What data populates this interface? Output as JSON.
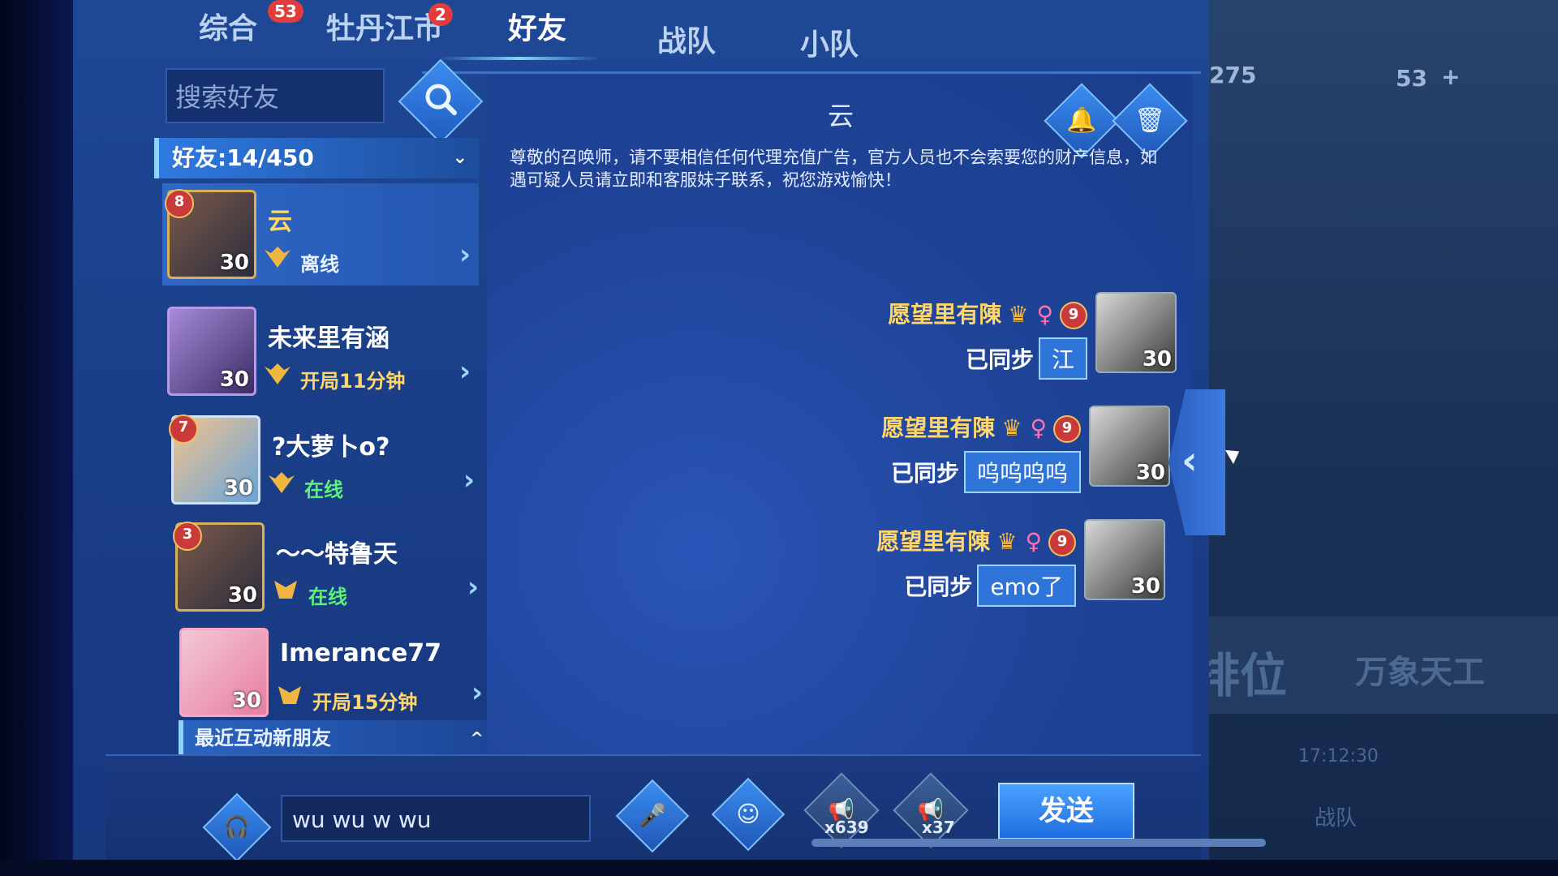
{
  "tabs": [
    {
      "label": "综合",
      "badge": "53"
    },
    {
      "label": "牡丹江市",
      "badge": "2"
    },
    {
      "label": "好友",
      "badge": ""
    },
    {
      "label": "战队",
      "badge": ""
    },
    {
      "label": "小队",
      "badge": ""
    }
  ],
  "search": {
    "placeholder": "搜索好友"
  },
  "friends_header": {
    "label": "好友:14/450",
    "chevron": "⌄"
  },
  "friends": [
    {
      "name": "云",
      "status": "离线",
      "level": "30",
      "rank_badge": "8"
    },
    {
      "name": "未来里有涵",
      "status": "开局11分钟",
      "level": "30",
      "rank_badge": ""
    },
    {
      "name": "?大萝卜o?",
      "status": "在线",
      "level": "30",
      "rank_badge": "7"
    },
    {
      "name": "～～特鲁天",
      "status": "在线",
      "level": "30",
      "rank_badge": "3"
    },
    {
      "name": "Imerance77",
      "status": "开局15分钟",
      "level": "30",
      "rank_badge": ""
    }
  ],
  "recent_section": {
    "label": "最近互动新朋友",
    "chevron": "^"
  },
  "chat": {
    "title": "云",
    "notice": "尊敬的召唤师，请不要相信任何代理充值广告，官方人员也不会索要您的财产信息，如遇可疑人员请立即和客服妹子联系，祝您游戏愉快！",
    "messages": [
      {
        "sender": "愿望里有陳",
        "level_badge": "9",
        "avatar_level": "30",
        "sync_label": "已同步",
        "text": "江"
      },
      {
        "sender": "愿望里有陳",
        "level_badge": "9",
        "avatar_level": "30",
        "sync_label": "已同步",
        "text": "呜呜呜呜"
      },
      {
        "sender": "愿望里有陳",
        "level_badge": "9",
        "avatar_level": "30",
        "sync_label": "已同步",
        "text": "emo了"
      }
    ]
  },
  "input": {
    "value": "wu wu w wu"
  },
  "horns": [
    {
      "count": "x639"
    },
    {
      "count": "x37"
    }
  ],
  "send_label": "发送",
  "background": {
    "stat1": "275",
    "stat2": "53",
    "plus": "+",
    "ranked_label": "排位",
    "wanxiang_label": "万象天工",
    "time_text": "17:12:30",
    "team_label": "战队"
  },
  "icons": {
    "search": "search-icon",
    "bell": "bell-icon",
    "trash": "trash-icon",
    "voice": "voice-chat-icon",
    "mic": "microphone-icon",
    "emoji": "emoji-icon",
    "horn": "horn-icon",
    "side_arrow": "chevron-left-icon"
  },
  "colors": {
    "accent": "#2f74d8",
    "gold": "#ffd66b",
    "online": "#5df07a",
    "badge_red": "#e23c3c"
  }
}
